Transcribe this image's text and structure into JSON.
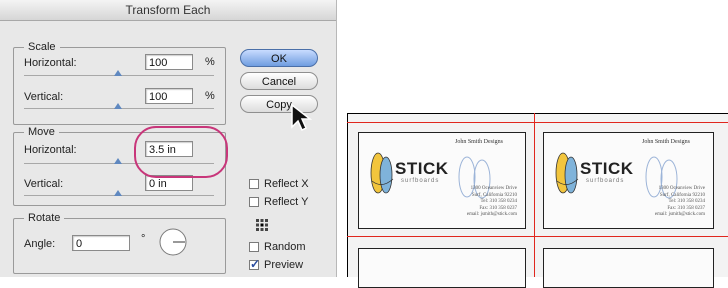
{
  "dialog": {
    "title": "Transform Each",
    "scale": {
      "title": "Scale",
      "horizontal_label": "Horizontal:",
      "horizontal_value": "100",
      "horizontal_unit": "%",
      "vertical_label": "Vertical:",
      "vertical_value": "100",
      "vertical_unit": "%"
    },
    "move": {
      "title": "Move",
      "horizontal_label": "Horizontal:",
      "horizontal_value": "3.5 in",
      "vertical_label": "Vertical:",
      "vertical_value": "0 in"
    },
    "rotate": {
      "title": "Rotate",
      "angle_label": "Angle:",
      "angle_value": "0",
      "angle_unit": "°"
    },
    "buttons": {
      "ok": "OK",
      "cancel": "Cancel",
      "copy": "Copy"
    },
    "options": {
      "reflect_x": "Reflect X",
      "reflect_y": "Reflect Y",
      "random": "Random",
      "preview": "Preview",
      "preview_checked": true
    },
    "accent_color": "#5f88c0",
    "highlight_color": "#c8367a"
  },
  "cards": [
    {
      "brand": "STICK",
      "brand_sub": "surfboards",
      "name": "John Smith Designs",
      "info": [
        "1300 Oceanview Drive",
        "Surf, California 92210",
        "Tel: 310 358 0234",
        "Fax: 310 358 0237",
        "email: jsmith@stick.com"
      ]
    },
    {
      "brand": "STICK",
      "brand_sub": "surfboards",
      "name": "John Smith Designs",
      "info": [
        "1300 Oceanview Drive",
        "Surf, California 92210",
        "Tel: 310 358 0234",
        "Fax: 310 358 0237",
        "email: jsmith@stick.com"
      ]
    }
  ],
  "crop_color": "#e0271e"
}
